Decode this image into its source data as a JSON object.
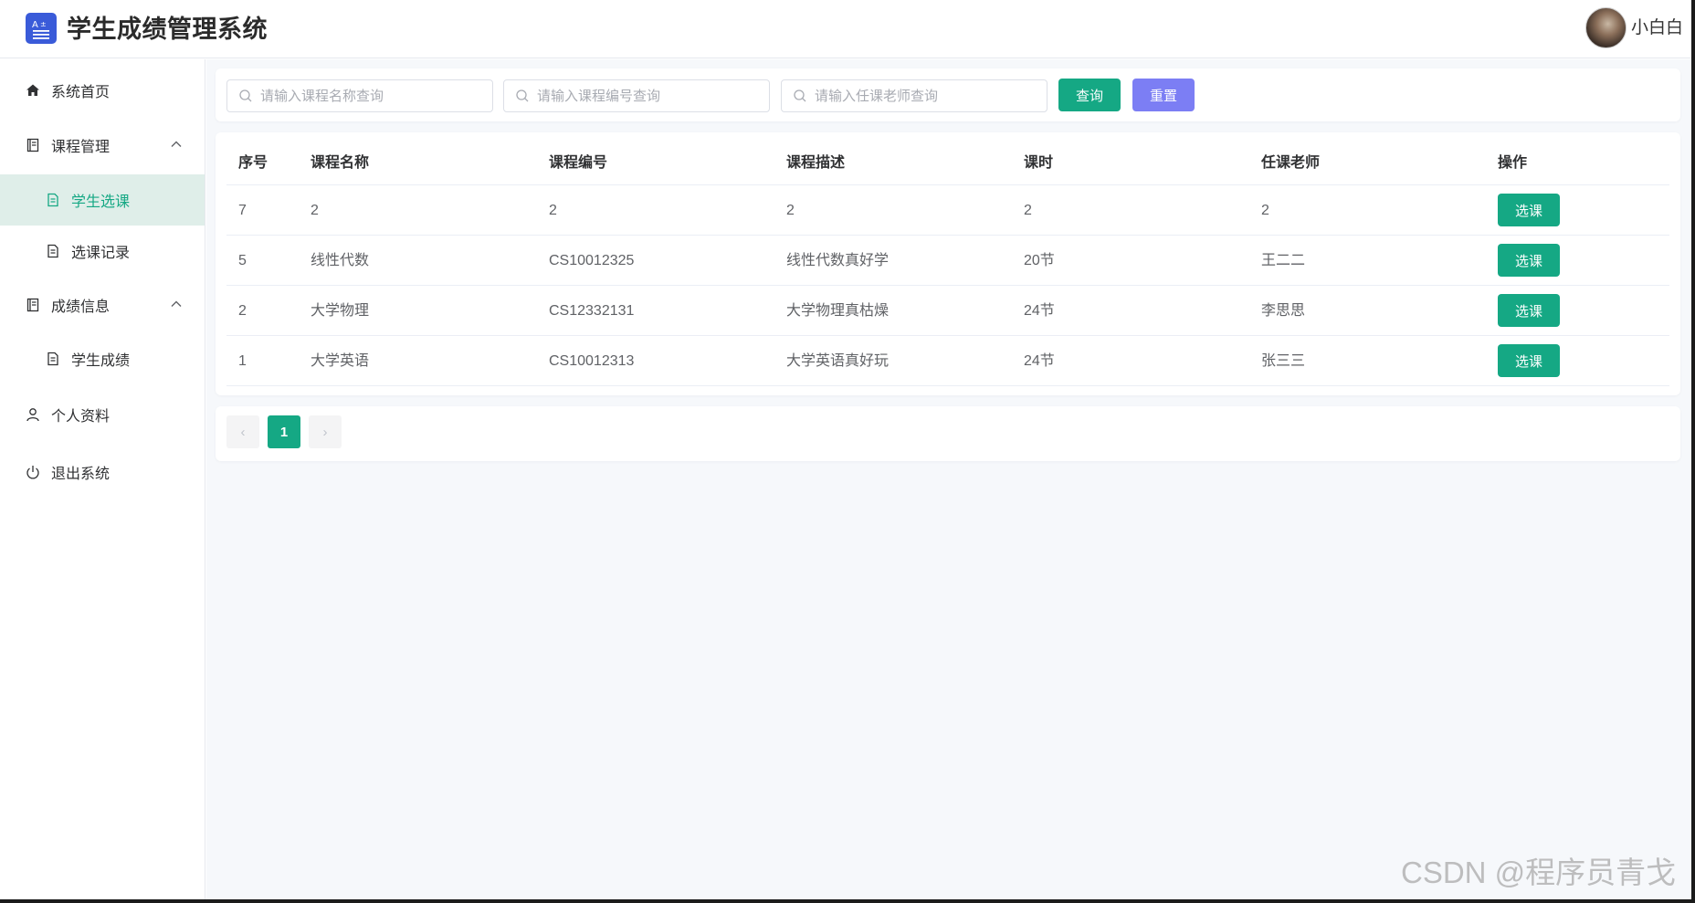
{
  "header": {
    "title": "学生成绩管理系统",
    "username": "小白白",
    "logo_icon": "document-text-icon"
  },
  "sidebar": {
    "items": [
      {
        "label": "系统首页",
        "icon": "home-icon"
      },
      {
        "label": "课程管理",
        "icon": "book-icon"
      },
      {
        "label": "学生选课",
        "icon": "document-icon"
      },
      {
        "label": "选课记录",
        "icon": "document-icon"
      },
      {
        "label": "成绩信息",
        "icon": "book-icon"
      },
      {
        "label": "学生成绩",
        "icon": "document-icon"
      },
      {
        "label": "个人资料",
        "icon": "user-icon"
      },
      {
        "label": "退出系统",
        "icon": "power-icon"
      }
    ],
    "active_item": "学生选课"
  },
  "search": {
    "course_name_placeholder": "请输入课程名称查询",
    "course_no_placeholder": "请输入课程编号查询",
    "teacher_placeholder": "请输入任课老师查询",
    "query_label": "查询",
    "reset_label": "重置"
  },
  "table": {
    "headers": [
      "序号",
      "课程名称",
      "课程编号",
      "课程描述",
      "课时",
      "任课老师",
      "操作"
    ],
    "rows": [
      {
        "id": "7",
        "name": "2",
        "code": "2",
        "desc": "2",
        "hours": "2",
        "teacher": "2",
        "action": "选课"
      },
      {
        "id": "5",
        "name": "线性代数",
        "code": "CS10012325",
        "desc": "线性代数真好学",
        "hours": "20节",
        "teacher": "王二二",
        "action": "选课"
      },
      {
        "id": "2",
        "name": "大学物理",
        "code": "CS12332131",
        "desc": "大学物理真枯燥",
        "hours": "24节",
        "teacher": "李思思",
        "action": "选课"
      },
      {
        "id": "1",
        "name": "大学英语",
        "code": "CS10012313",
        "desc": "大学英语真好玩",
        "hours": "24节",
        "teacher": "张三三",
        "action": "选课"
      }
    ]
  },
  "pagination": {
    "prev": "‹",
    "current": "1",
    "next": "›"
  },
  "watermark": "CSDN @程序员青戈",
  "colors": {
    "primary": "#15a884",
    "reset": "#7c7ef4",
    "logo": "#3a5bd9",
    "active_bg": "#dfeee9"
  }
}
